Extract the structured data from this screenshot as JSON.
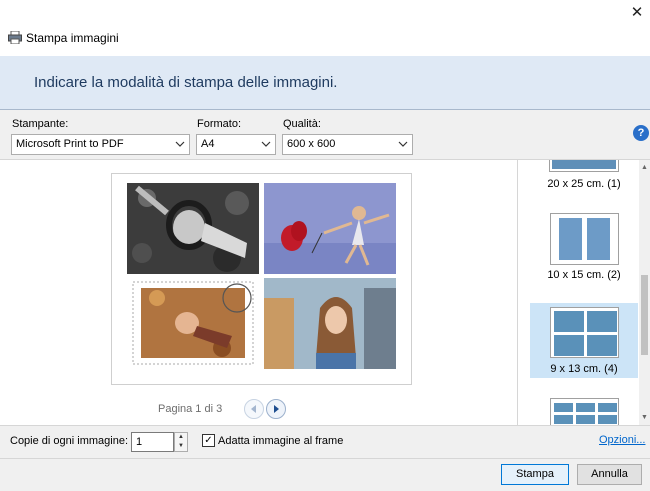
{
  "window": {
    "title": "Stampa immagini",
    "close_glyph": "✕",
    "icons": {
      "app": "printer-icon",
      "close": "close-icon",
      "help": "help-icon"
    }
  },
  "banner": {
    "text": "Indicare la modalità di stampa delle immagini."
  },
  "toolbar": {
    "printer_label": "Stampante:",
    "printer_value": "Microsoft Print to PDF",
    "format_label": "Formato:",
    "format_value": "A4",
    "quality_label": "Qualità:",
    "quality_value": "600 x 600",
    "help_glyph": "?"
  },
  "preview": {
    "pager_text": "Pagina 1 di 3",
    "photos": [
      {
        "name": "woman-lying-leaves-bw",
        "color": "#5a5a5a"
      },
      {
        "name": "girl-jumping-red-balloon",
        "color": "#8a93c8"
      },
      {
        "name": "stamp-woman-autumn-leaves",
        "color": "#c08a52"
      },
      {
        "name": "girl-blowing-kiss",
        "color": "#9a8770"
      }
    ]
  },
  "layouts": [
    {
      "label": "20 x 25 cm. (1)",
      "selected": false
    },
    {
      "label": "10 x 15 cm. (2)",
      "selected": false
    },
    {
      "label": "9 x 13 cm. (4)",
      "selected": true
    },
    {
      "label": "",
      "selected": false
    }
  ],
  "bottom": {
    "copies_label": "Copie di ogni immagine:",
    "copies_value": "1",
    "fit_label": "Adatta immagine al frame",
    "fit_checked": true,
    "options_link": "Opzioni...",
    "print_button": "Stampa",
    "cancel_button": "Annulla"
  }
}
